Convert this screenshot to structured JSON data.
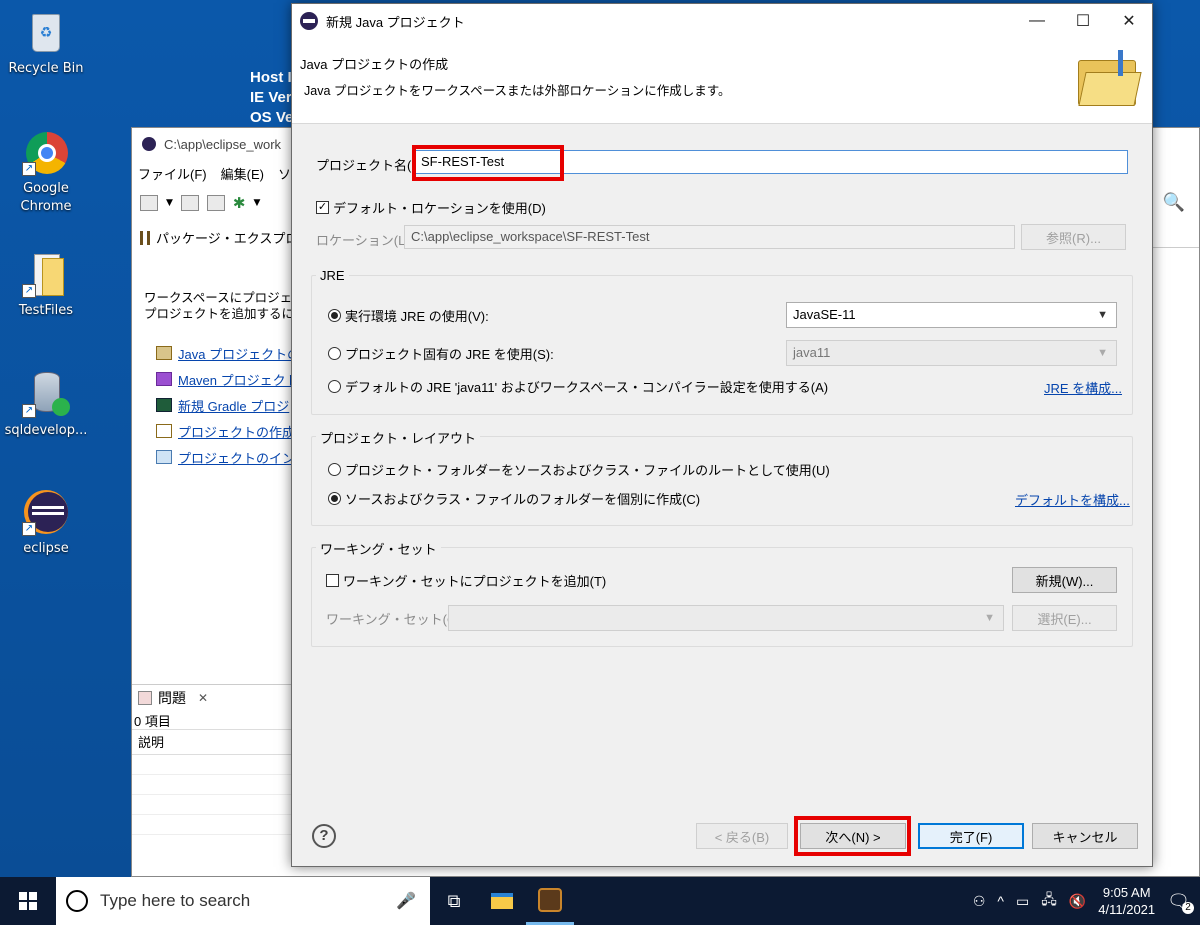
{
  "desktop": {
    "icons": [
      {
        "label": "Recycle Bin",
        "icon": "recycle-bin-icon"
      },
      {
        "label": "Google Chrome",
        "icon": "chrome-icon"
      },
      {
        "label": "TestFiles",
        "icon": "folder-icon"
      },
      {
        "label": "sqldevelop...",
        "icon": "sqldeveloper-icon"
      },
      {
        "label": "eclipse",
        "icon": "eclipse-icon"
      }
    ],
    "host_info": [
      "Host I",
      "IE Ver",
      "OS Ve"
    ]
  },
  "eclipse": {
    "title": "C:\\app\\eclipse_work",
    "menu": [
      "ファイル(F)",
      "編集(E)",
      "ソ"
    ],
    "package_view_title": "パッケージ・エクスプロー",
    "intro_line1": "ワークスペースにプロジェクト",
    "intro_line2": "プロジェクトを追加するには:",
    "links": [
      "Java プロジェクトの作",
      "Maven プロジェクトの",
      "新規 Gradle プロジ",
      "プロジェクトの作成...",
      "プロジェクトのインポ"
    ],
    "problems": {
      "tab": "問題",
      "count": "0 項目",
      "column": "説明"
    }
  },
  "dialog": {
    "title": "新規 Java プロジェクト",
    "header_title": "Java プロジェクトの作成",
    "header_desc": "Java プロジェクトをワークスペースまたは外部ロケーションに作成します。",
    "project_name_label": "プロジェクト名(P):",
    "project_name_value": "SF-REST-Test",
    "default_location_label": "デフォルト・ロケーションを使用(D)",
    "default_location_checked": true,
    "location_label": "ロケーション(L):",
    "location_value": "C:\\app\\eclipse_workspace\\SF-REST-Test",
    "browse_button": "参照(R)...",
    "jre": {
      "group_label": "JRE",
      "option1": "実行環境 JRE の使用(V):",
      "option1_value": "JavaSE-11",
      "option2": "プロジェクト固有の JRE を使用(S):",
      "option2_value": "java11",
      "option3": "デフォルトの JRE 'java11' およびワークスペース・コンパイラー設定を使用する(A)",
      "configure_link": "JRE を構成..."
    },
    "layout": {
      "group_label": "プロジェクト・レイアウト",
      "option1": "プロジェクト・フォルダーをソースおよびクラス・ファイルのルートとして使用(U)",
      "option2": "ソースおよびクラス・ファイルのフォルダーを個別に作成(C)",
      "configure_link": "デフォルトを構成..."
    },
    "working_sets": {
      "group_label": "ワーキング・セット",
      "add_checkbox": "ワーキング・セットにプロジェクトを追加(T)",
      "new_button": "新規(W)...",
      "sets_label": "ワーキング・セット(O):",
      "select_button": "選択(E)..."
    },
    "buttons": {
      "help": "?",
      "back": "< 戻る(B)",
      "next": "次へ(N) >",
      "finish": "完了(F)",
      "cancel": "キャンセル"
    }
  },
  "taskbar": {
    "search_placeholder": "Type here to search",
    "time": "9:05 AM",
    "date": "4/11/2021",
    "notification_count": "2"
  },
  "colors": {
    "desktop": "#0b58aa",
    "highlight": "#e60000",
    "link": "#0645ad",
    "taskbar": "#0c1a33"
  }
}
